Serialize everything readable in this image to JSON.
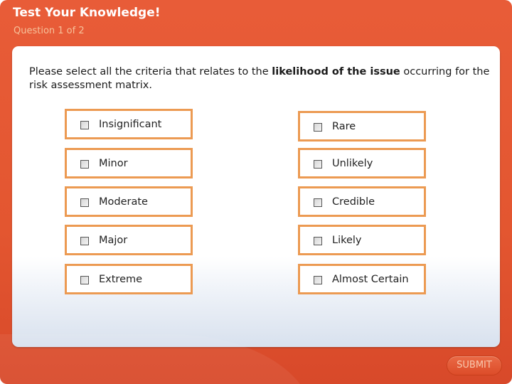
{
  "header": {
    "title": "Test Your Knowledge!",
    "subtitle": "Question 1 of 2"
  },
  "question": {
    "text_before": "Please select all the criteria that relates to the ",
    "text_bold": "likelihood of the issue",
    "text_after": " occurring for the risk assessment matrix."
  },
  "options_left": [
    {
      "label": "Insignificant",
      "checked": false
    },
    {
      "label": "Minor",
      "checked": false
    },
    {
      "label": "Moderate",
      "checked": false
    },
    {
      "label": "Major",
      "checked": false
    },
    {
      "label": "Extreme",
      "checked": false
    }
  ],
  "options_right": [
    {
      "label": "Rare",
      "checked": false
    },
    {
      "label": "Unlikely",
      "checked": false
    },
    {
      "label": "Credible",
      "checked": false
    },
    {
      "label": "Likely",
      "checked": false
    },
    {
      "label": "Almost Certain",
      "checked": false
    }
  ],
  "footer": {
    "submit_label": "SUBMIT"
  },
  "colors": {
    "brand": "#e35630",
    "option_border": "#ec9a52"
  }
}
